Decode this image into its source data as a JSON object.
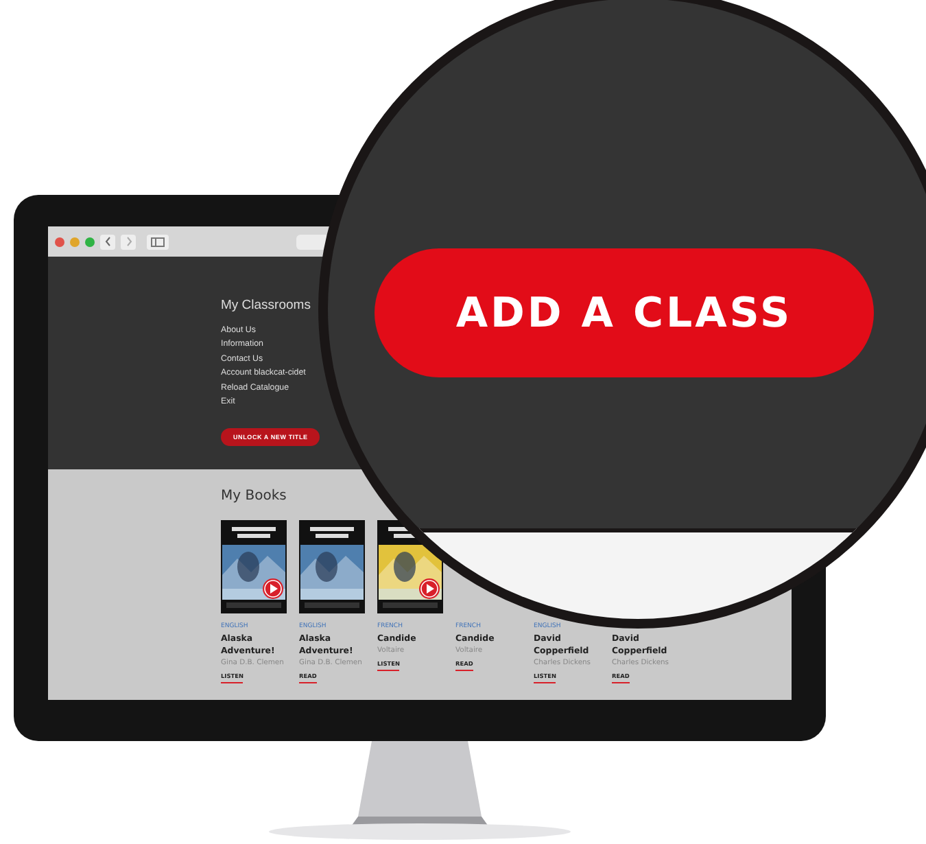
{
  "menu": {
    "title": "My Classrooms",
    "items": [
      "About Us",
      "Information",
      "Contact Us",
      "Account blackcat-cidet",
      "Reload Catalogue",
      "Exit"
    ],
    "button": "UNLOCK A NEW TITLE"
  },
  "books_section": {
    "title": "My Books",
    "books": [
      {
        "cover": {
          "kind": "picture",
          "color": "#4f7fae",
          "play": true
        },
        "language": "ENGLISH",
        "title": "Alaska Adventure!",
        "author": "Gina D.B. Clemen",
        "action": "LISTEN"
      },
      {
        "cover": {
          "kind": "picture",
          "color": "#4f7fae",
          "play": false
        },
        "language": "ENGLISH",
        "title": "Alaska Adventure!",
        "author": "Gina D.B. Clemen",
        "action": "READ"
      },
      {
        "cover": {
          "kind": "picture",
          "color": "#e2c23c",
          "play": true
        },
        "language": "FRENCH",
        "title": "Candide",
        "author": "Voltaire",
        "action": "LISTEN"
      },
      {
        "language": "FRENCH",
        "title": "Candide",
        "author": "Voltaire",
        "action": "READ"
      },
      {
        "language": "ENGLISH",
        "title": "David Copperfield",
        "author": "Charles Dickens",
        "action": "LISTEN"
      },
      {
        "title": "David Copperfield",
        "author": "Charles Dickens",
        "action": "READ"
      }
    ]
  },
  "magnifier": {
    "button": "ADD A CLASS"
  }
}
